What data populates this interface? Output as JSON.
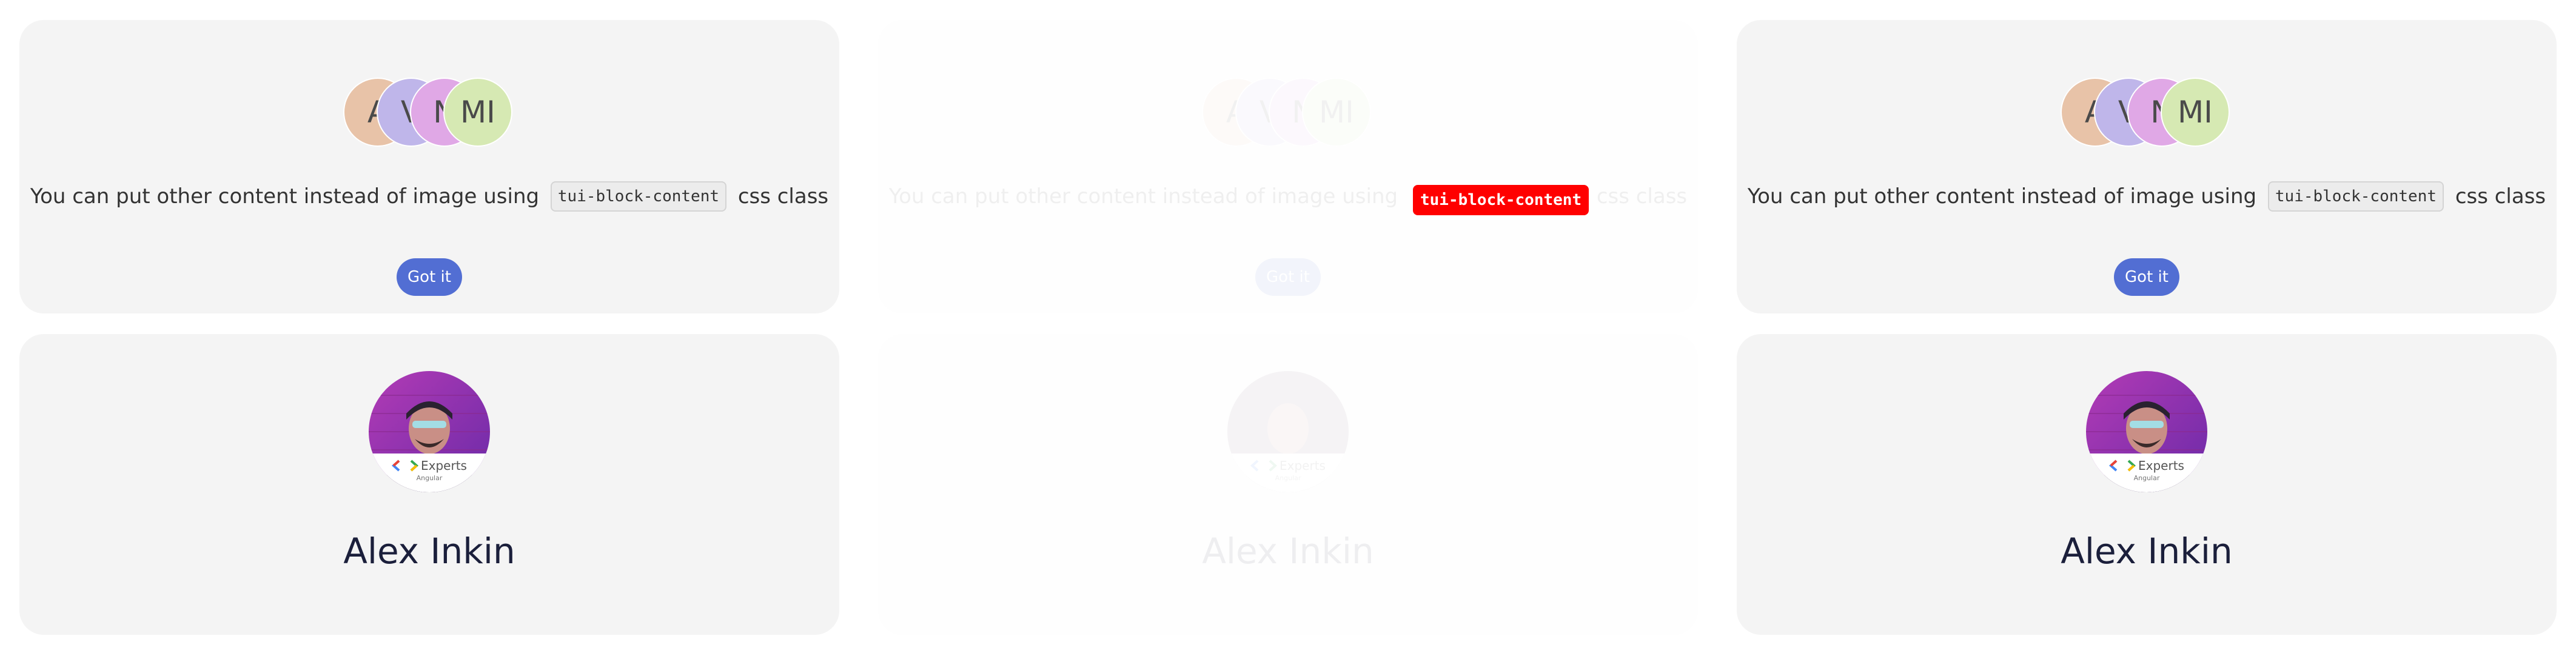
{
  "examples": [
    {
      "avatars": [
        {
          "initials": "A",
          "color": "#e8c3a8"
        },
        {
          "initials": "V",
          "color": "#bfb6ea"
        },
        {
          "initials": "N",
          "color": "#e0a8e6"
        },
        {
          "initials": "MI",
          "color": "#d6e9b3"
        }
      ],
      "message_before": "You can put other content instead of image using",
      "code": "tui-block-content",
      "message_after": "css class",
      "button_label": "Got it",
      "badge_title": "Experts",
      "badge_sub": "Angular",
      "name": "Alex Inkin"
    },
    {
      "avatars": [
        {
          "initials": "A",
          "color": "#e8c3a8"
        },
        {
          "initials": "V",
          "color": "#bfb6ea"
        },
        {
          "initials": "N",
          "color": "#e0a8e6"
        },
        {
          "initials": "MI",
          "color": "#d6e9b3"
        }
      ],
      "message_before": "You can put other content instead of image using",
      "code": "tui-block-content",
      "message_after": "css class",
      "button_label": "Got it",
      "badge_title": "Experts",
      "badge_sub": "Angular",
      "name": "Alex Inkin"
    },
    {
      "avatars": [
        {
          "initials": "A",
          "color": "#e8c3a8"
        },
        {
          "initials": "V",
          "color": "#bfb6ea"
        },
        {
          "initials": "N",
          "color": "#e0a8e6"
        },
        {
          "initials": "MI",
          "color": "#d6e9b3"
        }
      ],
      "message_before": "You can put other content instead of image using",
      "code": "tui-block-content",
      "message_after": "css class",
      "button_label": "Got it",
      "badge_title": "Experts",
      "badge_sub": "Angular",
      "name": "Alex Inkin"
    }
  ],
  "colors": {
    "card_bg": "#f4f4f4",
    "primary_button": "#526ed3",
    "highlight_code": "#ff0000",
    "name_text": "#1b1f3b"
  }
}
